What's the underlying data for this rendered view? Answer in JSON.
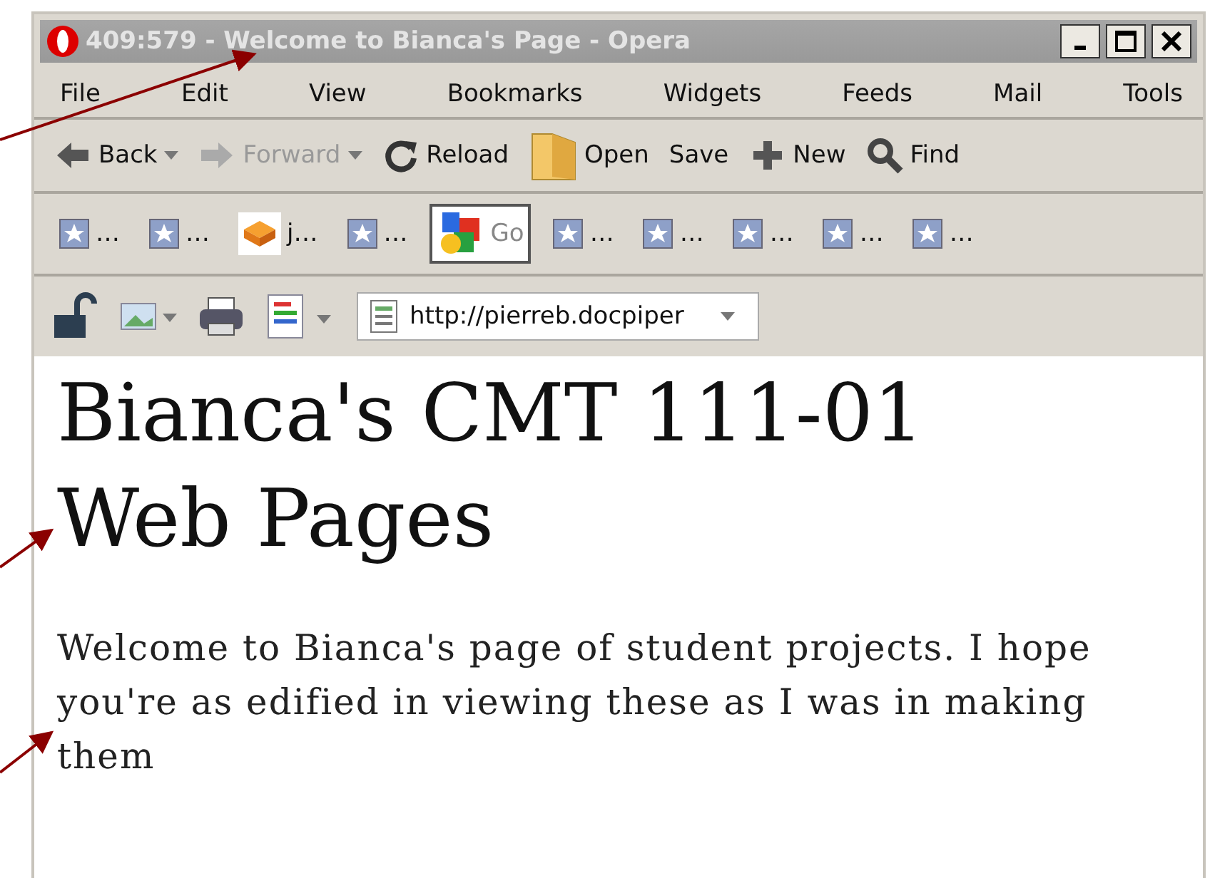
{
  "window": {
    "title": "409:579 - Welcome to Bianca's Page - Opera"
  },
  "menu": [
    "File",
    "Edit",
    "View",
    "Bookmarks",
    "Widgets",
    "Feeds",
    "Mail",
    "Tools"
  ],
  "toolbar": [
    {
      "kind": "back",
      "label": "Back",
      "disabled": false,
      "dropdown": true
    },
    {
      "kind": "forward",
      "label": "Forward",
      "disabled": true,
      "dropdown": true
    },
    {
      "kind": "reload",
      "label": "Reload",
      "disabled": false,
      "dropdown": false
    },
    {
      "kind": "open",
      "label": "Open",
      "disabled": false,
      "dropdown": false
    },
    {
      "kind": "save",
      "label": "Save",
      "disabled": false,
      "dropdown": false
    },
    {
      "kind": "new",
      "label": "New",
      "disabled": false,
      "dropdown": false
    },
    {
      "kind": "find",
      "label": "Find",
      "disabled": false,
      "dropdown": false
    }
  ],
  "bookmarks": [
    {
      "kind": "star",
      "label": "…",
      "selected": false
    },
    {
      "kind": "star",
      "label": "…",
      "selected": false
    },
    {
      "kind": "cube",
      "label": "j…",
      "selected": false
    },
    {
      "kind": "star",
      "label": "…",
      "selected": false
    },
    {
      "kind": "google",
      "label": "Go",
      "selected": true
    },
    {
      "kind": "star",
      "label": "…",
      "selected": false
    },
    {
      "kind": "star",
      "label": "…",
      "selected": false
    },
    {
      "kind": "star",
      "label": "…",
      "selected": false
    },
    {
      "kind": "star",
      "label": "…",
      "selected": false
    },
    {
      "kind": "star",
      "label": "…",
      "selected": false
    }
  ],
  "address": {
    "value": "http://pierreb.docpiper"
  },
  "page": {
    "heading": "Bianca's CMT 111-01 Web Pages",
    "paragraph": "Welcome to Bianca's page of student projects. I hope you're as edified in viewing these as I was in making them"
  }
}
